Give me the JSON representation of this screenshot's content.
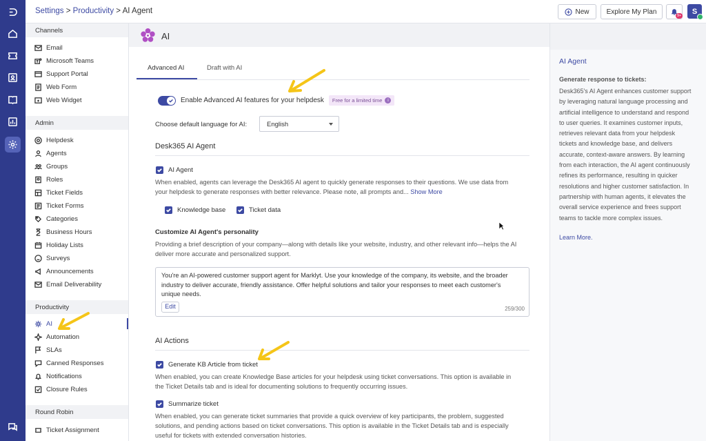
{
  "breadcrumb": {
    "settings": "Settings",
    "sep1": " > ",
    "productivity": "Productivity",
    "sep2": " > ",
    "current": "AI Agent"
  },
  "topbar": {
    "new_label": "New",
    "explore_label": "Explore My Plan",
    "notif_badge": "9+",
    "avatar_letter": "S"
  },
  "sidebar": {
    "channels_header": "Channels",
    "channels": [
      "Email",
      "Microsoft Teams",
      "Support Portal",
      "Web Form",
      "Web Widget"
    ],
    "admin_header": "Admin",
    "admin": [
      "Helpdesk",
      "Agents",
      "Groups",
      "Roles",
      "Ticket Fields",
      "Ticket Forms",
      "Categories",
      "Business Hours",
      "Holiday Lists",
      "Surveys",
      "Announcements",
      "Email Deliverability"
    ],
    "productivity_header": "Productivity",
    "productivity": [
      "AI",
      "Automation",
      "SLAs",
      "Canned Responses",
      "Notifications",
      "Closure Rules"
    ],
    "roundrobin_header": "Round Robin",
    "roundrobin": [
      "Ticket Assignment"
    ]
  },
  "page": {
    "title": "AI"
  },
  "tabs": {
    "advanced": "Advanced AI",
    "draft": "Draft with AI"
  },
  "toggle": {
    "label": "Enable Advanced AI features for your helpdesk",
    "badge": "Free for a limited time"
  },
  "language": {
    "label": "Choose default language for AI:",
    "value": "English"
  },
  "agent_section": {
    "title": "Desk365 AI Agent",
    "check_label": "AI Agent",
    "desc1": "When enabled, agents can leverage the Desk365 AI agent to quickly generate responses to their questions. We use data from",
    "desc2": "your helpdesk to generate responses with better relevance. Please note, all prompts and...",
    "show_more": "Show More",
    "kb_label": "Knowledge base",
    "ticket_label": "Ticket data"
  },
  "personality": {
    "title": "Customize AI Agent's personality",
    "desc1": "Providing a brief description of your company—along with details like your website, industry, and other relevant info—helps the AI",
    "desc2": "deliver more accurate and personalized support.",
    "text1": "You're an AI-powered customer support agent for Marklyt. Use your knowledge of the company, its website, and the broader",
    "text2": "industry to deliver accurate, friendly assistance. Offer helpful solutions and tailor your responses to meet each customer's",
    "text3": "unique needs.",
    "edit_label": "Edit",
    "counter": "259/300"
  },
  "actions": {
    "title": "AI Actions",
    "kb_check": "Generate KB Article from ticket",
    "kb_desc1": "When enabled, you can create Knowledge Base articles for your helpdesk using ticket conversations. This option is available in",
    "kb_desc2": "the Ticket Details tab and is ideal for documenting solutions to frequently occurring issues.",
    "sum_check": "Summarize ticket",
    "sum_desc1": "When enabled, you can generate ticket summaries that provide a quick overview of key participants, the problem, suggested",
    "sum_desc2": "solutions, and pending actions based on ticket conversations. This option is available in the Ticket Details tab and is especially",
    "sum_desc3": "useful for tickets with extended conversation histories."
  },
  "info_panel": {
    "title": "AI Agent",
    "subtitle": "Generate response to tickets:",
    "lines": [
      "Desk365's AI Agent enhances customer support",
      "by leveraging natural language processing and",
      "artificial intelligence to understand and respond",
      "to user queries. It examines customer inputs,",
      "retrieves relevant data from your helpdesk",
      "tickets and knowledge base, and delivers",
      "accurate, context-aware answers. By learning",
      "from each interaction, the AI agent continuously",
      "refines its performance, resulting in quicker",
      "resolutions and higher customer satisfaction. In",
      "partnership with human agents, it elevates the",
      "overall service experience and frees support",
      "teams to tackle more complex issues."
    ],
    "learn_more": "Learn More."
  },
  "colors": {
    "accent": "#3d4aa3",
    "rail": "#2f3b8c",
    "arrow": "#f5c518",
    "logo": "#b04fc4"
  }
}
